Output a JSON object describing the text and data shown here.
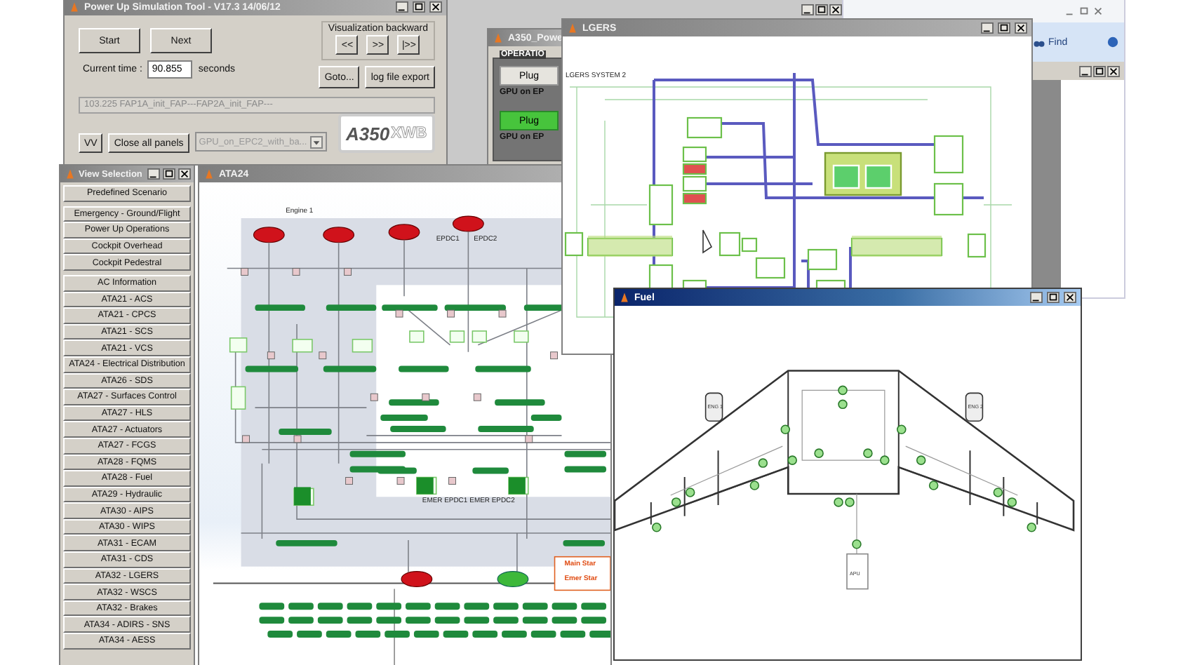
{
  "power_up_tool": {
    "title": "Power Up Simulation Tool - V17.3 14/06/12",
    "active": false,
    "step_buttons": [
      "Start",
      "Next"
    ],
    "visualization_label": "Visualization backward",
    "visualization_buttons": [
      "<<",
      ">>",
      "|>>"
    ],
    "time_label": "Current time :",
    "time_value": "90.855",
    "time_unit": "seconds",
    "goto_button": "Goto...",
    "export_button": "log file export",
    "log": "103.225 FAP1A_init_FAP---FAP2A_init_FAP---",
    "vv_button": "VV",
    "close_all_button": "Close all panels",
    "scenario_dropdown": "GPU_on_EPC2_with_ba...",
    "logo": {
      "text": "A350",
      "suffix": "XWB"
    }
  },
  "operations_window": {
    "title": "A350_Powe",
    "active": false,
    "group": "OPERATIO",
    "rows": [
      {
        "button": "Plug",
        "on": false,
        "label": "GPU on EP"
      },
      {
        "button": "Plug",
        "on": true,
        "label": "GPU on EP"
      }
    ]
  },
  "mail_window": {
    "find_button": "Find"
  },
  "view_selection": {
    "title": "View Selection",
    "active": false,
    "groups": [
      {
        "items": [
          "Predefined Scenario"
        ]
      },
      {
        "items": [
          "Emergency - Ground/Flight",
          "Power Up Operations",
          "Cockpit Overhead",
          "Cockpit Pedestral"
        ]
      },
      {
        "items": [
          "AC Information",
          "ATA21 - ACS",
          "ATA21 - CPCS",
          "ATA21 - SCS",
          "ATA21 - VCS",
          "ATA24 - Electrical Distribution",
          "ATA26 - SDS",
          "ATA27 - Surfaces Control",
          "ATA27 - HLS",
          "ATA27 - Actuators",
          "ATA27 - FCGS",
          "ATA28 - FQMS",
          "ATA28 - Fuel",
          "ATA29 - Hydraulic",
          "ATA30 - AIPS",
          "ATA30 - WIPS",
          "ATA31 - ECAM",
          "ATA31 - CDS",
          "ATA32 - LGERS",
          "ATA32 - WSCS",
          "ATA32 - Brakes",
          "ATA34 - ADIRS - SNS",
          "ATA34 - AESS"
        ]
      }
    ]
  },
  "ata24": {
    "title": "ATA24",
    "active": false,
    "labels": [
      {
        "text": "Engine 1",
        "kind": "note"
      },
      {
        "text": "EPDC1",
        "kind": "note"
      },
      {
        "text": "EPDC2",
        "kind": "note"
      },
      {
        "text": "EMER EPDC1",
        "kind": "note"
      },
      {
        "text": "EMER EPDC2",
        "kind": "note"
      },
      {
        "text": "Main Star",
        "kind": "start"
      },
      {
        "text": "Emer Star",
        "kind": "start"
      }
    ]
  },
  "lgers": {
    "title": "LGERS",
    "active": false,
    "system_label": "LGERS SYSTEM 2"
  },
  "fuel": {
    "title": "Fuel",
    "active": true,
    "engines": [
      "ENG 1",
      "ENG 2"
    ],
    "apu": "APU"
  }
}
